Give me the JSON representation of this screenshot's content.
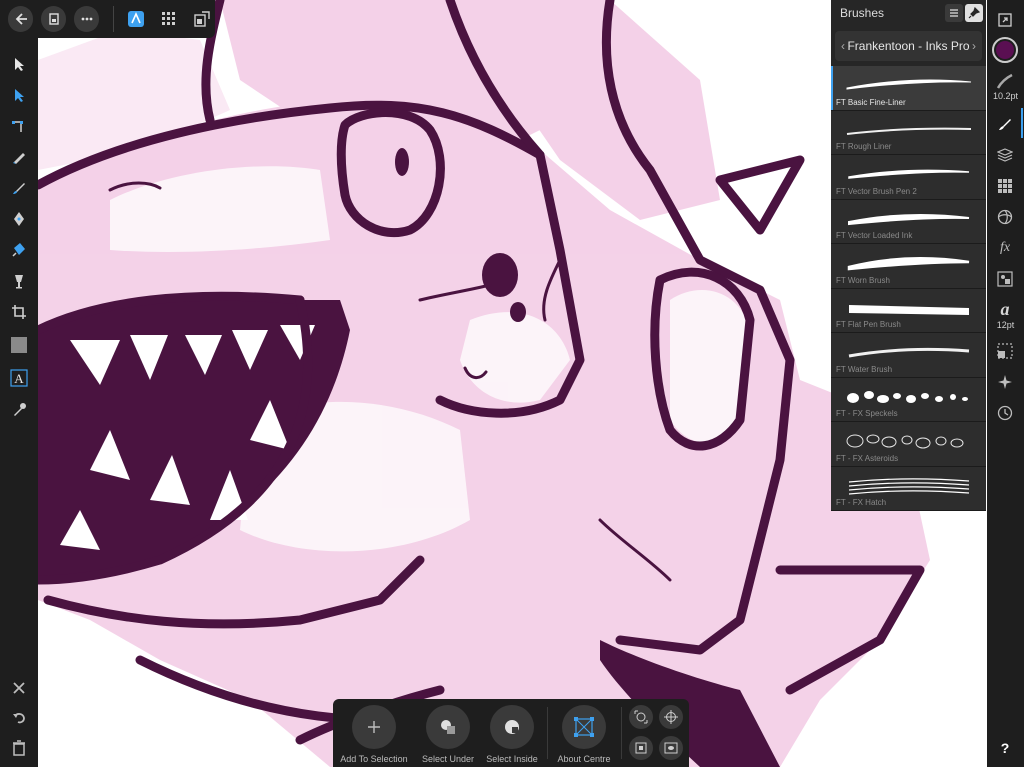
{
  "top_bar": {
    "back_icon": "back-arrow-icon",
    "document_icon": "document-icon",
    "more_icon": "more-icon",
    "persona_icon": "designer-persona-icon",
    "pixel_persona_icon": "pixel-persona-icon",
    "export_persona_icon": "export-persona-icon"
  },
  "left_tools": [
    "move-tool-icon",
    "node-tool-icon",
    "corner-tool-icon",
    "pencil-tool-icon",
    "vector-brush-tool-icon",
    "pen-tool-icon",
    "fill-tool-icon",
    "transparency-tool-icon",
    "crop-tool-icon",
    "rectangle-tool-icon",
    "text-tool-icon",
    "color-picker-tool-icon"
  ],
  "left_bottom": [
    "close-icon",
    "undo-icon",
    "delete-icon"
  ],
  "right_toolbar": {
    "color_swatch": "#5a0f52",
    "stroke_width_label": "10.2pt",
    "font_size_label": "12pt",
    "text_style_glyph": "a",
    "fx_glyph": "fx",
    "help_label": "?"
  },
  "brushes_panel": {
    "title": "Brushes",
    "category": "Frankentoon - Inks Pro",
    "items": [
      {
        "name": "FT Basic Fine-Liner",
        "selected": true
      },
      {
        "name": "FT Rough Liner",
        "selected": false
      },
      {
        "name": "FT Vector Brush Pen 2",
        "selected": false
      },
      {
        "name": "FT Vector Loaded Ink",
        "selected": false
      },
      {
        "name": "FT Worn Brush",
        "selected": false
      },
      {
        "name": "FT Flat Pen Brush",
        "selected": false
      },
      {
        "name": "FT Water Brush",
        "selected": false
      },
      {
        "name": "FT - FX Speckels",
        "selected": false
      },
      {
        "name": "FT - FX Asteroids",
        "selected": false
      },
      {
        "name": "FT - FX Hatch",
        "selected": false
      }
    ]
  },
  "context_toolbar": {
    "add_to_selection": "Add To Selection",
    "select_under": "Select Under",
    "select_inside": "Select Inside",
    "about_centre": "About Centre"
  },
  "colors": {
    "ink": "#4a1340",
    "pink_wash": "#f0c6e2",
    "accent_blue": "#3ea1f0"
  }
}
